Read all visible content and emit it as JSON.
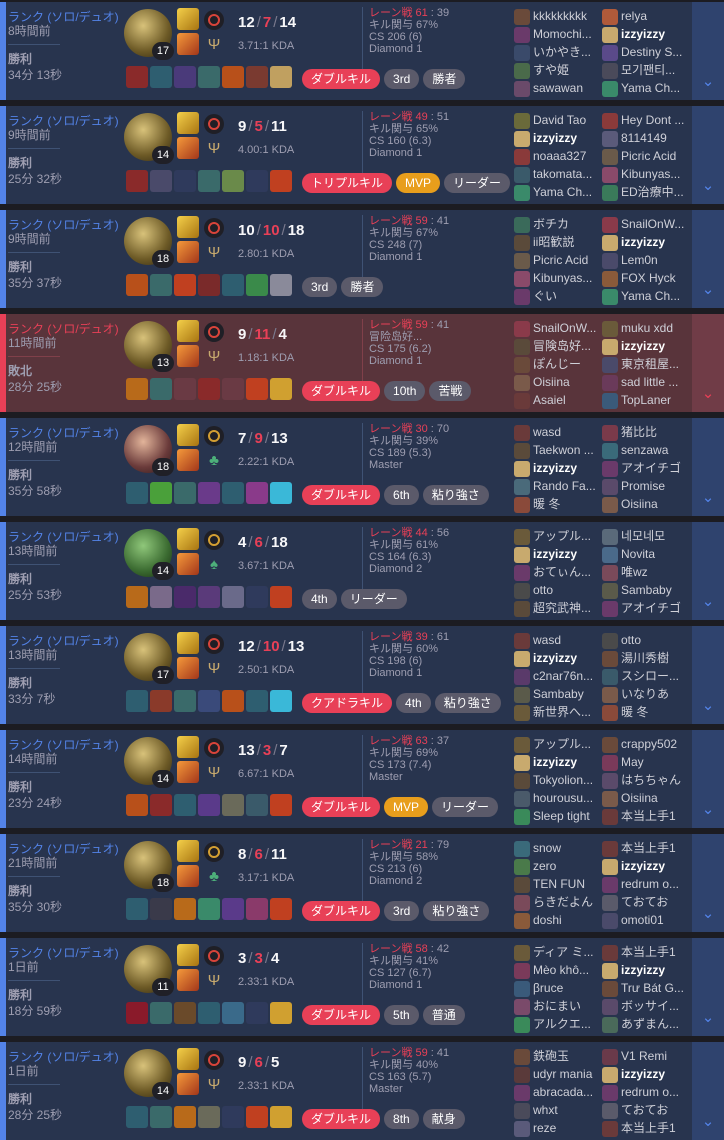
{
  "matches": [
    {
      "queue": "ランク (ソロ/デュオ)",
      "ago": "8時間前",
      "result": "勝利",
      "duration": "34分 13秒",
      "win": true,
      "champ": "c1",
      "level": "17",
      "rune2": "Ψ",
      "rune_style": "r1",
      "kills": "12",
      "deaths": "7",
      "assists": "14",
      "kda_ratio": "3.71:1 KDA",
      "lane": "レーン戦 61",
      "lane_opp": " : 39",
      "kill_part": "キル関与 67%",
      "cs": "CS 206 (6)",
      "rank": "Diamond 1",
      "items": [
        "#8a2a2a",
        "#2e5e70",
        "#4a3a7a",
        "#3a6a6a",
        "#b8501a",
        "#7a3a30",
        "#c0a060"
      ],
      "ward": "#3ab8d8",
      "tags": [
        {
          "text": "ダブルキル",
          "style": "red"
        },
        {
          "text": "3rd",
          "style": "gray"
        },
        {
          "text": "勝者",
          "style": "gray"
        }
      ],
      "team1": [
        {
          "name": "kkkkkkkkk",
          "c": "#6a4a3a"
        },
        {
          "name": "Momochi...",
          "c": "#6a3a6a"
        },
        {
          "name": "いかやき...",
          "c": "#3a4a6a"
        },
        {
          "name": "すや姫",
          "c": "#4a6a4a"
        },
        {
          "name": "sawawan",
          "c": "#6a4a6a"
        }
      ],
      "team2": [
        {
          "name": "relya",
          "c": "#b05a3a"
        },
        {
          "name": "izzyizzy",
          "c": "#c8aa6e",
          "me": true
        },
        {
          "name": "Destiny S...",
          "c": "#5a4a8a"
        },
        {
          "name": "모기팬티...",
          "c": "#4a4a5a"
        },
        {
          "name": "Yama Ch...",
          "c": "#3a8a6a"
        }
      ]
    },
    {
      "queue": "ランク (ソロ/デュオ)",
      "ago": "9時間前",
      "result": "勝利",
      "duration": "25分 32秒",
      "win": true,
      "champ": "c1",
      "level": "14",
      "rune2": "Ψ",
      "rune_style": "r1",
      "kills": "9",
      "deaths": "5",
      "assists": "11",
      "kda_ratio": "4.00:1 KDA",
      "lane": "レーン戦 49",
      "lane_opp": " : 51",
      "kill_part": "キル関与 65%",
      "cs": "CS 160 (6.3)",
      "rank": "Diamond 1",
      "items": [
        "#8a2a2a",
        "#4a4a6a",
        "#2f3a5c",
        "#3a6a6a",
        "#6a8a4a",
        "#2f3a5c",
        "#c04020"
      ],
      "ward": "",
      "tags": [
        {
          "text": "トリプルキル",
          "style": "red"
        },
        {
          "text": "MVP",
          "style": "gold"
        },
        {
          "text": "リーダー",
          "style": "gray"
        }
      ],
      "team1": [
        {
          "name": "David Tao",
          "c": "#6a6a3a"
        },
        {
          "name": "izzyizzy",
          "c": "#c8aa6e",
          "me": true
        },
        {
          "name": "noaaa327",
          "c": "#8a3a3a"
        },
        {
          "name": "takomata...",
          "c": "#3a5a6a"
        },
        {
          "name": "Yama Ch...",
          "c": "#3a8a6a"
        }
      ],
      "team2": [
        {
          "name": "Hey Dont ...",
          "c": "#8a3a3a"
        },
        {
          "name": "8114149",
          "c": "#5a5a7a"
        },
        {
          "name": "Picric Acid",
          "c": "#6a5a4a"
        },
        {
          "name": "Kibunyas...",
          "c": "#8a4a6a"
        },
        {
          "name": "ED治療中...",
          "c": "#3a7a5a"
        }
      ]
    },
    {
      "queue": "ランク (ソロ/デュオ)",
      "ago": "9時間前",
      "result": "勝利",
      "duration": "35分 37秒",
      "win": true,
      "champ": "c1",
      "level": "18",
      "rune2": "Ψ",
      "rune_style": "r1",
      "kills": "10",
      "deaths": "10",
      "assists": "18",
      "kda_ratio": "2.80:1 KDA",
      "lane": "レーン戦 59",
      "lane_opp": " : 41",
      "kill_part": "キル関与 67%",
      "cs": "CS 248 (7)",
      "rank": "Diamond 1",
      "items": [
        "#b8501a",
        "#3a6a6a",
        "#c04020",
        "#7a2a2a",
        "#2e5e70",
        "#3a8a4a",
        "#8a8a9a"
      ],
      "ward": "",
      "tags": [
        {
          "text": "3rd",
          "style": "gray"
        },
        {
          "text": "勝者",
          "style": "gray"
        }
      ],
      "team1": [
        {
          "name": "ボチカ",
          "c": "#3a6a5a"
        },
        {
          "name": "ii昭歓説",
          "c": "#5a4a3a"
        },
        {
          "name": "Picric Acid",
          "c": "#6a5a4a"
        },
        {
          "name": "Kibunyas...",
          "c": "#8a4a6a"
        },
        {
          "name": "ぐい",
          "c": "#6a3a6a"
        }
      ],
      "team2": [
        {
          "name": "SnailOnW...",
          "c": "#8a3a4a"
        },
        {
          "name": "izzyizzy",
          "c": "#c8aa6e",
          "me": true
        },
        {
          "name": "Lem0n",
          "c": "#4a4a6a"
        },
        {
          "name": "FOX Hyck",
          "c": "#8a5a3a"
        },
        {
          "name": "Yama Ch...",
          "c": "#3a8a6a"
        }
      ]
    },
    {
      "queue": "ランク (ソロ/デュオ)",
      "ago": "11時間前",
      "result": "敗北",
      "duration": "28分 25秒",
      "win": false,
      "champ": "c1",
      "level": "13",
      "rune2": "Ψ",
      "rune_style": "r1",
      "kills": "9",
      "deaths": "11",
      "assists": "4",
      "kda_ratio": "1.18:1 KDA",
      "lane": "レーン戦 59",
      "lane_opp": " : 41",
      "kill_part": "冒险岛好...",
      "cs": "CS 175 (6.2)",
      "rank": "Diamond 1",
      "items": [
        "#b86a1a",
        "#3a6a6a",
        "#6a3a44",
        "#8a2a2a",
        "#6a3a44",
        "#c04020",
        "#d0a030"
      ],
      "ward": "",
      "tags": [
        {
          "text": "ダブルキル",
          "style": "red"
        },
        {
          "text": "10th",
          "style": "gray"
        },
        {
          "text": "苦戦",
          "style": "gray"
        }
      ],
      "team1": [
        {
          "name": "SnailOnW...",
          "c": "#8a3a4a"
        },
        {
          "name": "冒険岛好...",
          "c": "#5a4a3a"
        },
        {
          "name": "ぽんじー",
          "c": "#6a4a3a"
        },
        {
          "name": "Oisiina",
          "c": "#7a5a4a"
        },
        {
          "name": "Asaiel",
          "c": "#6a3a3a"
        }
      ],
      "team2": [
        {
          "name": "muku xdd",
          "c": "#6a5a3a"
        },
        {
          "name": "izzyizzy",
          "c": "#c8aa6e",
          "me": true
        },
        {
          "name": "東京租屋...",
          "c": "#4a4a6a"
        },
        {
          "name": "sad little ...",
          "c": "#6a3a5a"
        },
        {
          "name": "TopLaner",
          "c": "#3a5a7a"
        }
      ]
    },
    {
      "queue": "ランク (ソロ/デュオ)",
      "ago": "12時間前",
      "result": "勝利",
      "duration": "35分 58秒",
      "win": true,
      "champ": "c2",
      "level": "18",
      "rune2": "♣",
      "rune_style": "r2",
      "kills": "7",
      "deaths": "9",
      "assists": "13",
      "kda_ratio": "2.22:1 KDA",
      "lane": "レーン戦 30",
      "lane_opp": " : 70",
      "kill_part": "キル関与 39%",
      "cs": "CS 189 (5.3)",
      "rank": "Master",
      "items": [
        "#2e5e70",
        "#4aa03a",
        "#3a6a6a",
        "#6a3a8a",
        "#2e5e70",
        "#8a3a8a",
        "#3ab8d8"
      ],
      "ward": "",
      "tags": [
        {
          "text": "ダブルキル",
          "style": "red"
        },
        {
          "text": "6th",
          "style": "gray"
        },
        {
          "text": "粘り強さ",
          "style": "gray"
        }
      ],
      "team1": [
        {
          "name": "wasd",
          "c": "#6a3a3a"
        },
        {
          "name": "Taekwon ...",
          "c": "#5a4a3a"
        },
        {
          "name": "izzyizzy",
          "c": "#c8aa6e",
          "me": true
        },
        {
          "name": "Rando Fa...",
          "c": "#4a6a7a"
        },
        {
          "name": "暖 冬",
          "c": "#8a4a3a"
        }
      ],
      "team2": [
        {
          "name": "猪比比",
          "c": "#7a3a4a"
        },
        {
          "name": "senzawa",
          "c": "#3a6a7a"
        },
        {
          "name": "アオイチゴ",
          "c": "#6a3a6a"
        },
        {
          "name": "Promise",
          "c": "#5a4a6a"
        },
        {
          "name": "Oisiina",
          "c": "#7a5a4a"
        }
      ]
    },
    {
      "queue": "ランク (ソロ/デュオ)",
      "ago": "13時間前",
      "result": "勝利",
      "duration": "25分 53秒",
      "win": true,
      "champ": "c3",
      "level": "14",
      "rune2": "♠",
      "rune_style": "r2",
      "kills": "4",
      "deaths": "6",
      "assists": "18",
      "kda_ratio": "3.67:1 KDA",
      "lane": "レーン戦 44",
      "lane_opp": " : 56",
      "kill_part": "キル関与 61%",
      "cs": "CS 164 (6.3)",
      "rank": "Diamond 2",
      "items": [
        "#b86a1a",
        "#7a6a8a",
        "#4a2a6a",
        "#5a3a7a",
        "#6a6a8a",
        "#2f3a5c",
        "#c04020"
      ],
      "ward": "",
      "tags": [
        {
          "text": "4th",
          "style": "gray"
        },
        {
          "text": "リーダー",
          "style": "gray"
        }
      ],
      "team1": [
        {
          "name": "アップル...",
          "c": "#6a5a3a"
        },
        {
          "name": "izzyizzy",
          "c": "#c8aa6e",
          "me": true
        },
        {
          "name": "おてぃん...",
          "c": "#6a3a6a"
        },
        {
          "name": "otto",
          "c": "#4a4a4a"
        },
        {
          "name": "超究武神...",
          "c": "#5a4a3a"
        }
      ],
      "team2": [
        {
          "name": "네모네모",
          "c": "#5a6a7a"
        },
        {
          "name": "Novita",
          "c": "#4a6a8a"
        },
        {
          "name": "唯wz",
          "c": "#7a4a5a"
        },
        {
          "name": "Sambaby",
          "c": "#5a5a4a"
        },
        {
          "name": "アオイチゴ",
          "c": "#6a3a6a"
        }
      ]
    },
    {
      "queue": "ランク (ソロ/デュオ)",
      "ago": "13時間前",
      "result": "勝利",
      "duration": "33分 7秒",
      "win": true,
      "champ": "c1",
      "level": "17",
      "rune2": "Ψ",
      "rune_style": "r1",
      "kills": "12",
      "deaths": "10",
      "assists": "13",
      "kda_ratio": "2.50:1 KDA",
      "lane": "レーン戦 39",
      "lane_opp": " : 61",
      "kill_part": "キル関与 60%",
      "cs": "CS 198 (6)",
      "rank": "Diamond 1",
      "items": [
        "#2e5e70",
        "#8a3a2a",
        "#3a6a6a",
        "#3a4a7a",
        "#b8501a",
        "#2e5e70",
        "#3ab8d8"
      ],
      "ward": "",
      "tags": [
        {
          "text": "クアドラキル",
          "style": "red"
        },
        {
          "text": "4th",
          "style": "gray"
        },
        {
          "text": "粘り強さ",
          "style": "gray"
        }
      ],
      "team1": [
        {
          "name": "wasd",
          "c": "#6a3a3a"
        },
        {
          "name": "izzyizzy",
          "c": "#c8aa6e",
          "me": true
        },
        {
          "name": "c2nar76n...",
          "c": "#5a3a6a"
        },
        {
          "name": "Sambaby",
          "c": "#5a5a4a"
        },
        {
          "name": "新世界へ...",
          "c": "#6a5a3a"
        }
      ],
      "team2": [
        {
          "name": "otto",
          "c": "#4a4a4a"
        },
        {
          "name": "湯川秀樹",
          "c": "#6a4a3a"
        },
        {
          "name": "スシロー...",
          "c": "#3a5a6a"
        },
        {
          "name": "いなりあ",
          "c": "#7a5a4a"
        },
        {
          "name": "暖 冬",
          "c": "#8a4a3a"
        }
      ]
    },
    {
      "queue": "ランク (ソロ/デュオ)",
      "ago": "14時間前",
      "result": "勝利",
      "duration": "23分 24秒",
      "win": true,
      "champ": "c1",
      "level": "14",
      "rune2": "Ψ",
      "rune_style": "r1",
      "kills": "13",
      "deaths": "3",
      "assists": "7",
      "kda_ratio": "6.67:1 KDA",
      "lane": "レーン戦 63",
      "lane_opp": " : 37",
      "kill_part": "キル関与 69%",
      "cs": "CS 173 (7.4)",
      "rank": "Master",
      "items": [
        "#b8501a",
        "#8a2a2a",
        "#2e5e70",
        "#5a3a8a",
        "#6a6a5a",
        "#3a5a6a",
        "#c04020"
      ],
      "ward": "",
      "tags": [
        {
          "text": "ダブルキル",
          "style": "red"
        },
        {
          "text": "MVP",
          "style": "gold"
        },
        {
          "text": "リーダー",
          "style": "gray"
        }
      ],
      "team1": [
        {
          "name": "アップル...",
          "c": "#6a5a3a"
        },
        {
          "name": "izzyizzy",
          "c": "#c8aa6e",
          "me": true
        },
        {
          "name": "Tokyolion...",
          "c": "#5a4a3a"
        },
        {
          "name": "hourousu...",
          "c": "#4a5a6a"
        },
        {
          "name": "Sleep tight",
          "c": "#3a8a5a"
        }
      ],
      "team2": [
        {
          "name": "crappy502",
          "c": "#6a4a3a"
        },
        {
          "name": "May",
          "c": "#7a3a5a"
        },
        {
          "name": "はちちゃん",
          "c": "#5a4a6a"
        },
        {
          "name": "Oisiina",
          "c": "#7a5a4a"
        },
        {
          "name": "本当上手1",
          "c": "#6a3a3a"
        }
      ]
    },
    {
      "queue": "ランク (ソロ/デュオ)",
      "ago": "21時間前",
      "result": "勝利",
      "duration": "35分 30秒",
      "win": true,
      "champ": "c1",
      "level": "18",
      "rune2": "♣",
      "rune_style": "r2",
      "kills": "8",
      "deaths": "6",
      "assists": "11",
      "kda_ratio": "3.17:1 KDA",
      "lane": "レーン戦 21",
      "lane_opp": " : 79",
      "kill_part": "キル関与 58%",
      "cs": "CS 213 (6)",
      "rank": "Diamond 2",
      "items": [
        "#2e5e70",
        "#3a3a4a",
        "#b86a1a",
        "#3a8a6a",
        "#5a3a8a",
        "#8a3a6a",
        "#c04020"
      ],
      "ward": "",
      "tags": [
        {
          "text": "ダブルキル",
          "style": "red"
        },
        {
          "text": "3rd",
          "style": "gray"
        },
        {
          "text": "粘り強さ",
          "style": "gray"
        }
      ],
      "team1": [
        {
          "name": "snow",
          "c": "#3a6a7a"
        },
        {
          "name": "zero",
          "c": "#4a7a4a"
        },
        {
          "name": "TEN FUN",
          "c": "#5a4a3a"
        },
        {
          "name": "らきだよん",
          "c": "#7a4a5a"
        },
        {
          "name": "doshi",
          "c": "#8a5a3a"
        }
      ],
      "team2": [
        {
          "name": "本当上手1",
          "c": "#6a3a3a"
        },
        {
          "name": "izzyizzy",
          "c": "#c8aa6e",
          "me": true
        },
        {
          "name": "redrum o...",
          "c": "#6a3a6a"
        },
        {
          "name": "ておてお",
          "c": "#5a5a6a"
        },
        {
          "name": "omoti01",
          "c": "#4a4a6a"
        }
      ]
    },
    {
      "queue": "ランク (ソロ/デュオ)",
      "ago": "1日前",
      "result": "勝利",
      "duration": "18分 59秒",
      "win": true,
      "champ": "c1",
      "level": "11",
      "rune2": "Ψ",
      "rune_style": "r1",
      "kills": "3",
      "deaths": "3",
      "assists": "4",
      "kda_ratio": "2.33:1 KDA",
      "lane": "レーン戦 58",
      "lane_opp": " : 42",
      "kill_part": "キル関与 41%",
      "cs": "CS 127 (6.7)",
      "rank": "Diamond 1",
      "items": [
        "#8a1a2a",
        "#3a6a6a",
        "#6a4a2a",
        "#2e5e70",
        "#3a6a8a",
        "#2f3a5c",
        "#d0a030"
      ],
      "ward": "",
      "tags": [
        {
          "text": "ダブルキル",
          "style": "red"
        },
        {
          "text": "5th",
          "style": "gray"
        },
        {
          "text": "普通",
          "style": "gray"
        }
      ],
      "team1": [
        {
          "name": "ディア ミ...",
          "c": "#6a5a3a"
        },
        {
          "name": "Mèo khô...",
          "c": "#7a3a5a"
        },
        {
          "name": "βruce",
          "c": "#3a5a7a"
        },
        {
          "name": "おにまい",
          "c": "#7a4a6a"
        },
        {
          "name": "アルクエ...",
          "c": "#3a8a5a"
        }
      ],
      "team2": [
        {
          "name": "本当上手1",
          "c": "#6a3a3a"
        },
        {
          "name": "izzyizzy",
          "c": "#c8aa6e",
          "me": true
        },
        {
          "name": "Trư Bát G...",
          "c": "#6a4a3a"
        },
        {
          "name": "ボッサイ...",
          "c": "#5a4a6a"
        },
        {
          "name": "あずまん...",
          "c": "#4a6a5a"
        }
      ]
    },
    {
      "queue": "ランク (ソロ/デュオ)",
      "ago": "1日前",
      "result": "勝利",
      "duration": "28分 25秒",
      "win": true,
      "champ": "c1",
      "level": "14",
      "rune2": "Ψ",
      "rune_style": "r1",
      "kills": "9",
      "deaths": "6",
      "assists": "5",
      "kda_ratio": "2.33:1 KDA",
      "lane": "レーン戦 59",
      "lane_opp": " : 41",
      "kill_part": "キル関与 40%",
      "cs": "CS 163 (5.7)",
      "rank": "Master",
      "items": [
        "#2e5e70",
        "#3a6a6a",
        "#b86a1a",
        "#6a6a5a",
        "#2f3a5c",
        "#c04020",
        "#d0a030"
      ],
      "ward": "",
      "tags": [
        {
          "text": "ダブルキル",
          "style": "red"
        },
        {
          "text": "8th",
          "style": "gray"
        },
        {
          "text": "献身",
          "style": "gray"
        }
      ],
      "team1": [
        {
          "name": "鉄砲玉",
          "c": "#6a4a3a"
        },
        {
          "name": "udyr mania",
          "c": "#5a3a3a"
        },
        {
          "name": "abracada...",
          "c": "#6a3a6a"
        },
        {
          "name": "whxt",
          "c": "#4a4a5a"
        },
        {
          "name": "reze",
          "c": "#5a5a7a"
        }
      ],
      "team2": [
        {
          "name": "V1 Remi",
          "c": "#6a3a4a"
        },
        {
          "name": "izzyizzy",
          "c": "#c8aa6e",
          "me": true
        },
        {
          "name": "redrum o...",
          "c": "#6a3a6a"
        },
        {
          "name": "ておてお",
          "c": "#5a5a6a"
        },
        {
          "name": "本当上手1",
          "c": "#6a3a3a"
        }
      ]
    }
  ]
}
